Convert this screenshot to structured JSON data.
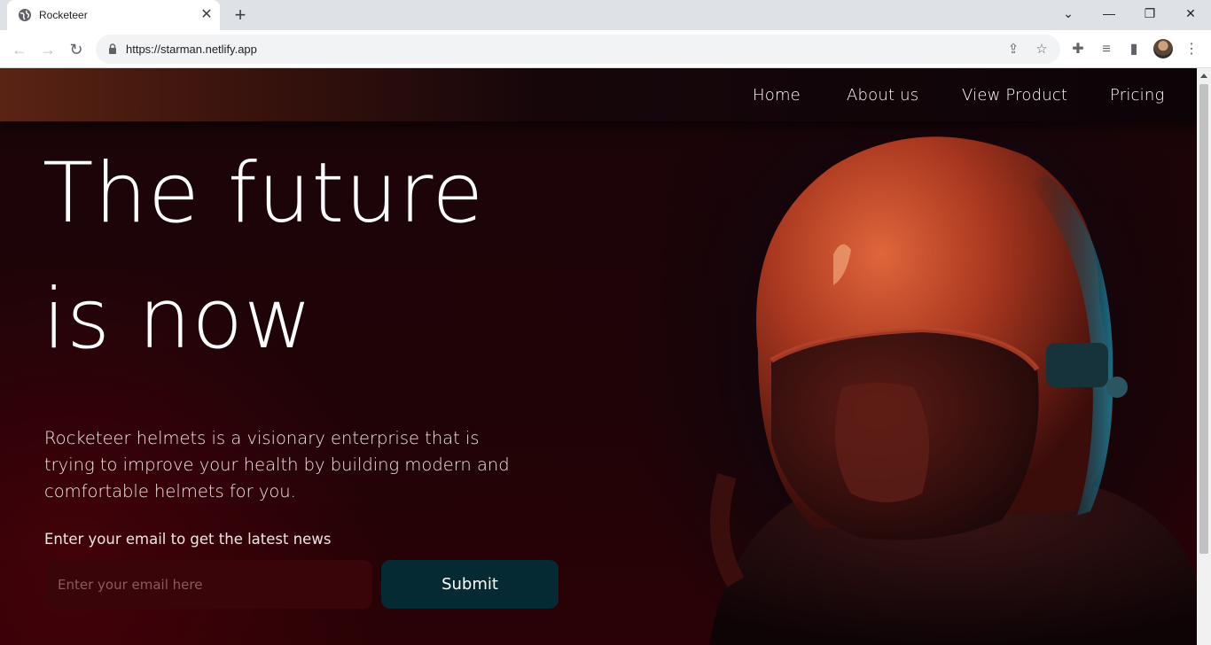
{
  "browser": {
    "tab_title": "Rocketeer",
    "url": "https://starman.netlify.app",
    "window_controls": [
      "chevron-down-icon",
      "minimize-icon",
      "restore-icon",
      "close-icon"
    ]
  },
  "nav": {
    "links": [
      "Home",
      "About us",
      "View Product",
      "Pricing"
    ]
  },
  "hero": {
    "headline_line1": "The future",
    "headline_line2": "is now",
    "description": "Rocketeer helmets is a visionary enterprise that is trying to improve your health by building modern and comfortable helmets for you.",
    "newsletter_label": "Enter your email to get the latest news",
    "email_placeholder": "Enter your email here",
    "submit_label": "Submit"
  },
  "colors": {
    "input_bg": "#3a0509",
    "button_bg": "#062a33",
    "helmet_orange": "#c8502c",
    "helmet_teal": "#1d6f86"
  }
}
